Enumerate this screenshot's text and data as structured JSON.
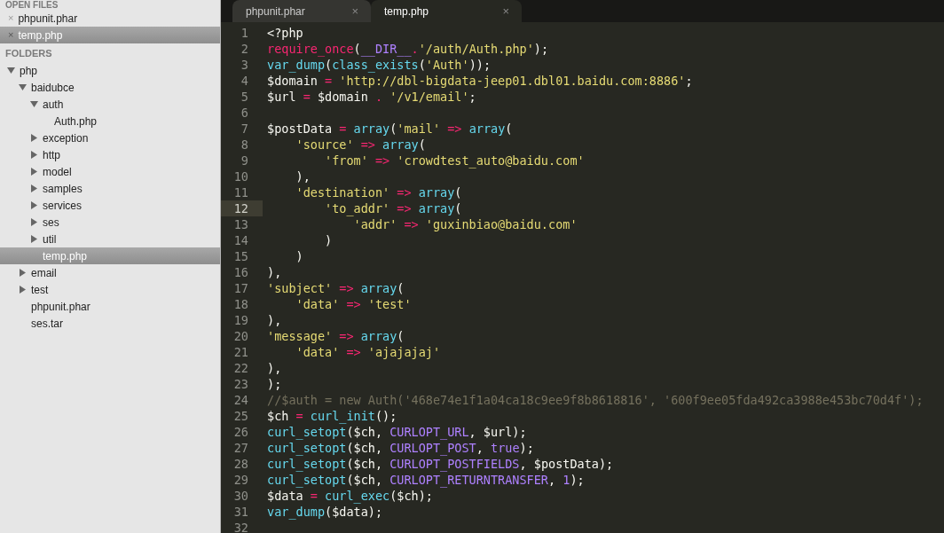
{
  "sidebar": {
    "open_files_header": "OPEN FILES",
    "open_files": [
      {
        "name": "phpunit.phar",
        "close": "×",
        "selected": false
      },
      {
        "name": "temp.php",
        "close": "×",
        "selected": true
      }
    ],
    "folders_header": "FOLDERS",
    "tree": [
      {
        "kind": "folder",
        "name": "php",
        "expanded": true,
        "selected": false,
        "children": [
          {
            "kind": "folder",
            "name": "baidubce",
            "expanded": true,
            "selected": false,
            "children": [
              {
                "kind": "folder",
                "name": "auth",
                "expanded": true,
                "selected": false,
                "children": [
                  {
                    "kind": "file",
                    "name": "Auth.php",
                    "selected": false
                  }
                ]
              },
              {
                "kind": "folder",
                "name": "exception",
                "expanded": false,
                "selected": false
              },
              {
                "kind": "folder",
                "name": "http",
                "expanded": false,
                "selected": false
              },
              {
                "kind": "folder",
                "name": "model",
                "expanded": false,
                "selected": false
              },
              {
                "kind": "folder",
                "name": "samples",
                "expanded": false,
                "selected": false
              },
              {
                "kind": "folder",
                "name": "services",
                "expanded": false,
                "selected": false
              },
              {
                "kind": "folder",
                "name": "ses",
                "expanded": false,
                "selected": false
              },
              {
                "kind": "folder",
                "name": "util",
                "expanded": false,
                "selected": false
              },
              {
                "kind": "file",
                "name": "temp.php",
                "selected": true
              }
            ]
          },
          {
            "kind": "folder",
            "name": "email",
            "expanded": false,
            "selected": false
          },
          {
            "kind": "folder",
            "name": "test",
            "expanded": false,
            "selected": false
          },
          {
            "kind": "file",
            "name": "phpunit.phar",
            "selected": false
          },
          {
            "kind": "file",
            "name": "ses.tar",
            "selected": false
          }
        ]
      }
    ]
  },
  "tabs": [
    {
      "label": "phpunit.phar",
      "close": "×",
      "selected": false
    },
    {
      "label": "temp.php",
      "close": "×",
      "selected": true
    }
  ],
  "editor": {
    "lines": [
      {
        "number": "1",
        "current": false,
        "tokens": [
          {
            "kind": "plain",
            "text": "<?php"
          }
        ]
      },
      {
        "number": "2",
        "current": false,
        "tokens": [
          {
            "kind": "keyword",
            "text": "require_once"
          },
          {
            "kind": "plain",
            "text": "("
          },
          {
            "kind": "constant",
            "text": "__DIR__"
          },
          {
            "kind": "keyword",
            "text": "."
          },
          {
            "kind": "string",
            "text": "'/auth/Auth.php'"
          },
          {
            "kind": "plain",
            "text": ");"
          }
        ]
      },
      {
        "number": "3",
        "current": false,
        "tokens": [
          {
            "kind": "function",
            "text": "var_dump"
          },
          {
            "kind": "plain",
            "text": "("
          },
          {
            "kind": "function",
            "text": "class_exists"
          },
          {
            "kind": "plain",
            "text": "("
          },
          {
            "kind": "string",
            "text": "'Auth'"
          },
          {
            "kind": "plain",
            "text": "));"
          }
        ]
      },
      {
        "number": "4",
        "current": false,
        "tokens": [
          {
            "kind": "plain",
            "text": "$domain"
          },
          {
            "kind": "keyword",
            "text": " = "
          },
          {
            "kind": "string",
            "text": "'http://dbl-bigdata-jeep01.dbl01.baidu.com:8886'"
          },
          {
            "kind": "plain",
            "text": ";"
          }
        ]
      },
      {
        "number": "5",
        "current": false,
        "tokens": [
          {
            "kind": "plain",
            "text": "$url"
          },
          {
            "kind": "keyword",
            "text": " = "
          },
          {
            "kind": "plain",
            "text": "$domain"
          },
          {
            "kind": "keyword",
            "text": " . "
          },
          {
            "kind": "string",
            "text": "'/v1/email'"
          },
          {
            "kind": "plain",
            "text": ";"
          }
        ]
      },
      {
        "number": "6",
        "current": false
      },
      {
        "number": "7",
        "current": false,
        "tokens": [
          {
            "kind": "plain",
            "text": "$postData"
          },
          {
            "kind": "keyword",
            "text": " = "
          },
          {
            "kind": "function",
            "text": "array"
          },
          {
            "kind": "plain",
            "text": "("
          },
          {
            "kind": "string",
            "text": "'mail'"
          },
          {
            "kind": "keyword",
            "text": " => "
          },
          {
            "kind": "function",
            "text": "array"
          },
          {
            "kind": "plain",
            "text": "("
          }
        ]
      },
      {
        "number": "8",
        "current": false,
        "tokens": [
          {
            "kind": "string",
            "text": "    'source'"
          },
          {
            "kind": "keyword",
            "text": " => "
          },
          {
            "kind": "function",
            "text": "array"
          },
          {
            "kind": "plain",
            "text": "("
          }
        ]
      },
      {
        "number": "9",
        "current": false,
        "tokens": [
          {
            "kind": "string",
            "text": "        'from'"
          },
          {
            "kind": "keyword",
            "text": " => "
          },
          {
            "kind": "string",
            "text": "'crowdtest_auto@baidu.com'"
          }
        ]
      },
      {
        "number": "10",
        "current": false,
        "tokens": [
          {
            "kind": "plain",
            "text": "    ),"
          }
        ]
      },
      {
        "number": "11",
        "current": false,
        "tokens": [
          {
            "kind": "string",
            "text": "    'destination'"
          },
          {
            "kind": "keyword",
            "text": " => "
          },
          {
            "kind": "function",
            "text": "array"
          },
          {
            "kind": "plain",
            "text": "("
          }
        ]
      },
      {
        "number": "12",
        "current": true,
        "tokens": [
          {
            "kind": "string",
            "text": "        'to_addr'"
          },
          {
            "kind": "keyword",
            "text": " => "
          },
          {
            "kind": "function",
            "text": "array"
          },
          {
            "kind": "plain",
            "text": "("
          }
        ]
      },
      {
        "number": "13",
        "current": false,
        "tokens": [
          {
            "kind": "string",
            "text": "            'addr'"
          },
          {
            "kind": "keyword",
            "text": " => "
          },
          {
            "kind": "string",
            "text": "'guxinbiao@baidu.com'"
          }
        ]
      },
      {
        "number": "14",
        "current": false,
        "tokens": [
          {
            "kind": "plain",
            "text": "        )"
          }
        ]
      },
      {
        "number": "15",
        "current": false,
        "tokens": [
          {
            "kind": "plain",
            "text": "    )"
          }
        ]
      },
      {
        "number": "16",
        "current": false,
        "tokens": [
          {
            "kind": "plain",
            "text": "),"
          }
        ]
      },
      {
        "number": "17",
        "current": false,
        "tokens": [
          {
            "kind": "string",
            "text": "'subject'"
          },
          {
            "kind": "keyword",
            "text": " => "
          },
          {
            "kind": "function",
            "text": "array"
          },
          {
            "kind": "plain",
            "text": "("
          }
        ]
      },
      {
        "number": "18",
        "current": false,
        "tokens": [
          {
            "kind": "string",
            "text": "    'data'"
          },
          {
            "kind": "keyword",
            "text": " => "
          },
          {
            "kind": "string",
            "text": "'test'"
          }
        ]
      },
      {
        "number": "19",
        "current": false,
        "tokens": [
          {
            "kind": "plain",
            "text": "),"
          }
        ]
      },
      {
        "number": "20",
        "current": false,
        "tokens": [
          {
            "kind": "string",
            "text": "'message'"
          },
          {
            "kind": "keyword",
            "text": " => "
          },
          {
            "kind": "function",
            "text": "array"
          },
          {
            "kind": "plain",
            "text": "("
          }
        ]
      },
      {
        "number": "21",
        "current": false,
        "tokens": [
          {
            "kind": "string",
            "text": "    'data'"
          },
          {
            "kind": "keyword",
            "text": " => "
          },
          {
            "kind": "string",
            "text": "'ajajajaj'"
          }
        ]
      },
      {
        "number": "22",
        "current": false,
        "tokens": [
          {
            "kind": "plain",
            "text": "),"
          }
        ]
      },
      {
        "number": "23",
        "current": false,
        "tokens": [
          {
            "kind": "plain",
            "text": ");"
          }
        ]
      },
      {
        "number": "24",
        "current": false,
        "tokens": [
          {
            "kind": "comment",
            "text": "//$auth = new Auth('468e74e1f1a04ca18c9ee9f8b8618816', '600f9ee05fda492ca3988e453bc70d4f');"
          }
        ]
      },
      {
        "number": "25",
        "current": false,
        "tokens": [
          {
            "kind": "plain",
            "text": "$ch"
          },
          {
            "kind": "keyword",
            "text": " = "
          },
          {
            "kind": "function",
            "text": "curl_init"
          },
          {
            "kind": "plain",
            "text": "();"
          }
        ]
      },
      {
        "number": "26",
        "current": false,
        "tokens": [
          {
            "kind": "function",
            "text": "curl_setopt"
          },
          {
            "kind": "plain",
            "text": "($ch, "
          },
          {
            "kind": "constant",
            "text": "CURLOPT_URL"
          },
          {
            "kind": "plain",
            "text": ", $url);"
          }
        ]
      },
      {
        "number": "27",
        "current": false,
        "tokens": [
          {
            "kind": "function",
            "text": "curl_setopt"
          },
          {
            "kind": "plain",
            "text": "($ch, "
          },
          {
            "kind": "constant",
            "text": "CURLOPT_POST"
          },
          {
            "kind": "plain",
            "text": ", "
          },
          {
            "kind": "constant",
            "text": "true"
          },
          {
            "kind": "plain",
            "text": ");"
          }
        ]
      },
      {
        "number": "28",
        "current": false,
        "tokens": [
          {
            "kind": "function",
            "text": "curl_setopt"
          },
          {
            "kind": "plain",
            "text": "($ch, "
          },
          {
            "kind": "constant",
            "text": "CURLOPT_POSTFIELDS"
          },
          {
            "kind": "plain",
            "text": ", $postData);"
          }
        ]
      },
      {
        "number": "29",
        "current": false,
        "tokens": [
          {
            "kind": "function",
            "text": "curl_setopt"
          },
          {
            "kind": "plain",
            "text": "($ch, "
          },
          {
            "kind": "constant",
            "text": "CURLOPT_RETURNTRANSFER"
          },
          {
            "kind": "plain",
            "text": ", "
          },
          {
            "kind": "constant",
            "text": "1"
          },
          {
            "kind": "plain",
            "text": ");"
          }
        ]
      },
      {
        "number": "30",
        "current": false,
        "tokens": [
          {
            "kind": "plain",
            "text": "$data"
          },
          {
            "kind": "keyword",
            "text": " = "
          },
          {
            "kind": "function",
            "text": "curl_exec"
          },
          {
            "kind": "plain",
            "text": "($ch);"
          }
        ]
      },
      {
        "number": "31",
        "current": false,
        "tokens": [
          {
            "kind": "function",
            "text": "var_dump"
          },
          {
            "kind": "plain",
            "text": "($data);"
          }
        ]
      },
      {
        "number": "32",
        "current": false
      }
    ]
  }
}
